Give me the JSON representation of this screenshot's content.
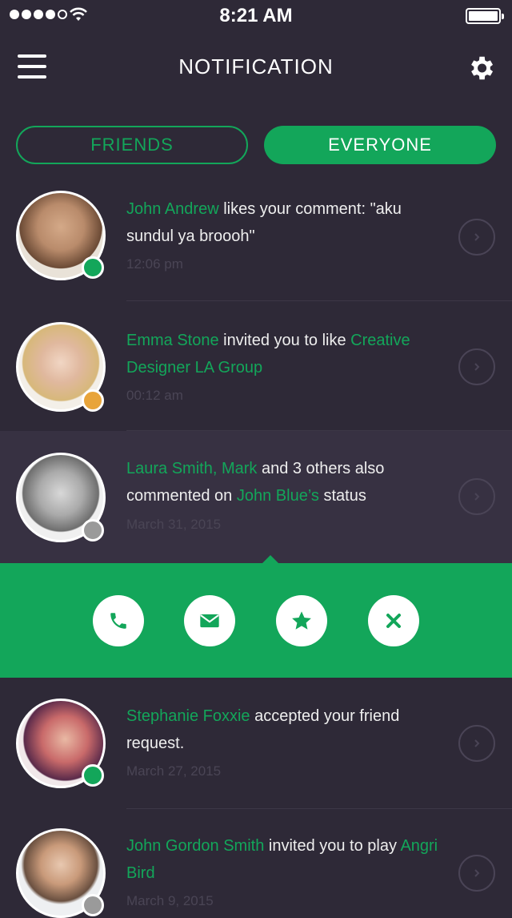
{
  "status_bar": {
    "time": "8:21 AM"
  },
  "header": {
    "title": "NOTIFICATION"
  },
  "tabs": [
    {
      "label": "FRIENDS",
      "active": false
    },
    {
      "label": "EVERYONE",
      "active": true
    }
  ],
  "notifications": [
    {
      "name": "John Andrew",
      "text": " likes your comment: \"aku sundul ya broooh\"",
      "time": "12:06 pm",
      "status": "online"
    },
    {
      "name": "Emma Stone",
      "text": " invited you to like ",
      "target": "Creative Designer LA Group",
      "time": "00:12 am",
      "status": "away"
    },
    {
      "name": "Laura Smith, Mark",
      "text": " and 3 others also commented on ",
      "target": "John Blue’s",
      "text2": " status",
      "time": "March 31, 2015",
      "status": "offline"
    },
    {
      "name": "Stephanie Foxxie",
      "text": " accepted your friend request.",
      "time": "March 27, 2015",
      "status": "online"
    },
    {
      "name": "John Gordon Smith",
      "text": " invited you to play ",
      "target": "Angri Bird",
      "time": "March 9, 2015",
      "status": "offline"
    }
  ],
  "actions": [
    "phone-icon",
    "mail-icon",
    "star-icon",
    "close-icon"
  ],
  "colors": {
    "background": "#2e2937",
    "accent": "#13a65a",
    "online": "#13a65a",
    "away": "#e8a43a",
    "offline": "#9a9a9a"
  }
}
